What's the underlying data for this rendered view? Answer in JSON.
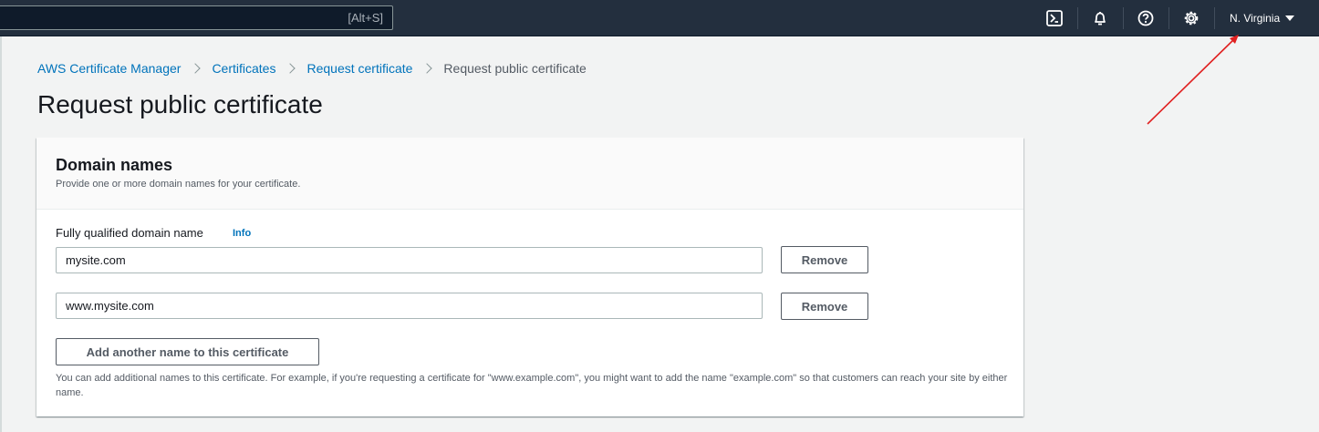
{
  "topnav": {
    "search_shortcut": "[Alt+S]",
    "region": "N. Virginia",
    "icons": [
      "cloudshell-icon",
      "notifications-icon",
      "help-icon",
      "settings-icon"
    ]
  },
  "breadcrumb": {
    "items": [
      "AWS Certificate Manager",
      "Certificates",
      "Request certificate"
    ],
    "current": "Request public certificate"
  },
  "page": {
    "title": "Request public certificate"
  },
  "domain_panel": {
    "title": "Domain names",
    "description": "Provide one or more domain names for your certificate.",
    "field_label": "Fully qualified domain name",
    "info_label": "Info",
    "domains": [
      "mysite.com",
      "www.mysite.com"
    ],
    "remove_label": "Remove",
    "add_label": "Add another name to this certificate",
    "help_text": "You can add additional names to this certificate. For example, if you're requesting a certificate for \"www.example.com\", you might want to add the name \"example.com\" so that customers can reach your site by either name."
  },
  "colors": {
    "nav_bg": "#232f3e",
    "link": "#0073bb",
    "annotation": "#e02020"
  }
}
